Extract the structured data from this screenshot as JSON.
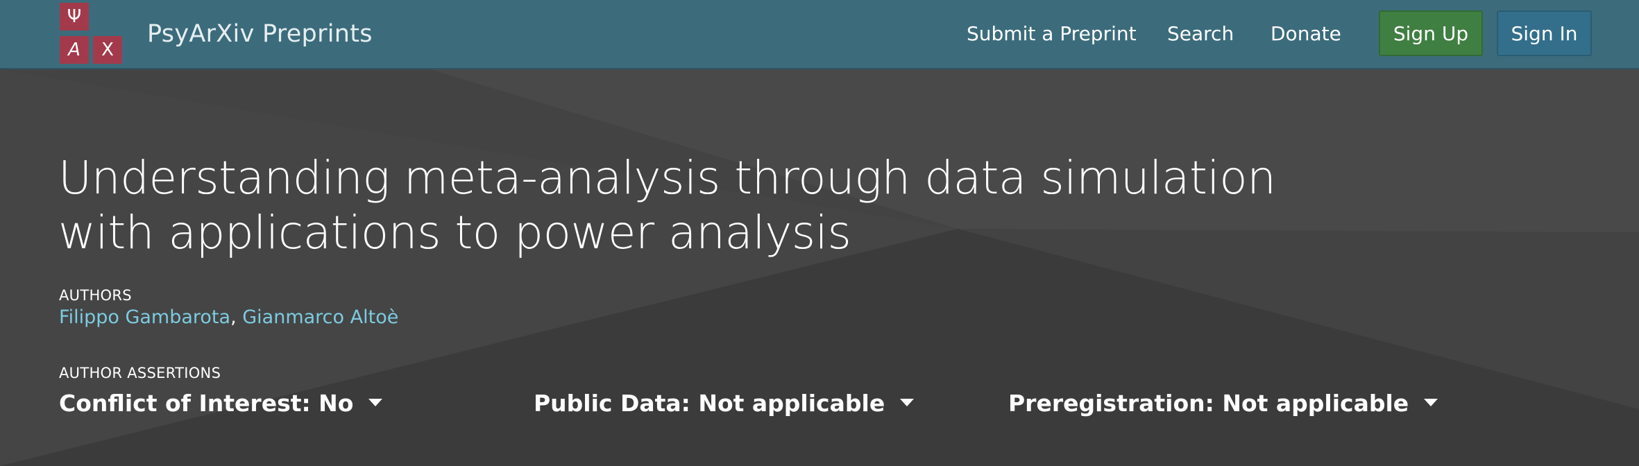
{
  "logo": {
    "glyphs": [
      "Ψ",
      "A",
      "Χ"
    ]
  },
  "brand": "PsyArXiv Preprints",
  "nav": {
    "submit": "Submit a Preprint",
    "search": "Search",
    "donate": "Donate",
    "sign_up": "Sign Up",
    "sign_in": "Sign In"
  },
  "preprint": {
    "title": "Understanding meta-analysis through data simulation with applications to power analysis",
    "authors_label": "AUTHORS",
    "authors": [
      "Filippo Gambarota",
      "Gianmarco Altoè"
    ],
    "author_separator": ",",
    "assertions_label": "AUTHOR ASSERTIONS",
    "assertions": {
      "conflict": "Conflict of Interest: No",
      "public_data": "Public Data: Not applicable",
      "preregistration": "Preregistration: Not applicable"
    }
  },
  "colors": {
    "navbar": "#3c6c7c",
    "logo_tile": "#a33a4b",
    "sign_up": "#3f7f42",
    "sign_in": "#336f8a",
    "hero_bg": "#3d3d3d",
    "author_link": "#7dcbe0"
  },
  "icons": [
    "caret-down-icon"
  ]
}
